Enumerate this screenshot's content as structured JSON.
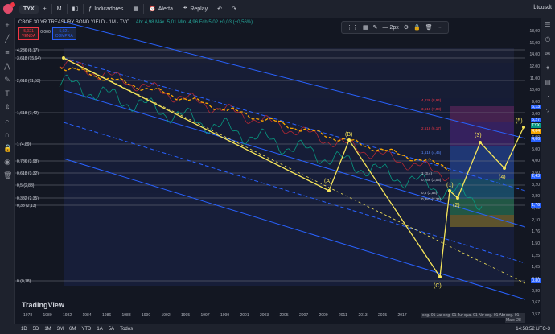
{
  "topbar": {
    "symbol": "TYX",
    "interval": "M",
    "indicators_label": "Indicadores",
    "alert_label": "Alerta",
    "replay_label": "Replay",
    "username": "btcusdt"
  },
  "legend": {
    "title": "CBOE 30 YR TREASURY BOND YIELD · 1M · TVC",
    "ohlc": "Abr 4,98  Máx. 5,01  Mín. 4,96  Fch 5,02  +0,03 (+0,56%)"
  },
  "trade": {
    "sell_price": "5,021",
    "sell_label": "VENDA",
    "spread": "0,000",
    "buy_price": "5,021",
    "buy_label": "COMPRA"
  },
  "drawing_toolbar": {
    "width_label": "2px"
  },
  "fib_levels": [
    {
      "label": "4,236 (8,17)"
    },
    {
      "label": "3,618 (15,64)"
    },
    {
      "label": "2,618 (11,53)"
    },
    {
      "label": "1,618 (7,42)"
    },
    {
      "label": "1 (4,89)"
    },
    {
      "label": "0,786 (3,98)"
    },
    {
      "label": "0,618 (3,32)"
    },
    {
      "label": "0,5 (2,83)"
    },
    {
      "label": "0,382 (2,35)"
    },
    {
      "label": "0,33 (2,13)"
    },
    {
      "label": "0 (0,78)"
    }
  ],
  "inner_fib_levels": [
    {
      "label": "4,236 (8,94)"
    },
    {
      "label": "3,618 (7,88)"
    },
    {
      "label": "2,618 (6,17)"
    },
    {
      "label": "1,618 (4,45)"
    },
    {
      "label": "1 (3,4)"
    },
    {
      "label": "0,786 (3,03)"
    },
    {
      "label": "0,5 (2,54)"
    },
    {
      "label": "0,382 (2,34)"
    }
  ],
  "wave_labels": {
    "a": "(A)",
    "b": "(B)",
    "c": "(C)",
    "w1": "(1)",
    "w2": "(2)",
    "w3": "(3)",
    "w4": "(4)",
    "w5": "(5)"
  },
  "price_axis": [
    "18,00",
    "16,00",
    "14,00",
    "12,00",
    "11,00",
    "10,00",
    "9,00",
    "8,00",
    "7,00",
    "6,00",
    "5,00",
    "4,00",
    "3,60",
    "3,20",
    "2,80",
    "2,43",
    "2,10",
    "1,76",
    "1,50",
    "1,25",
    "1,05",
    "0,91",
    "0,80",
    "0,67",
    "0,57"
  ],
  "price_tags": [
    {
      "text": "6,13",
      "color": "#2962ff"
    },
    {
      "text": "5,27",
      "color": "#2962ff"
    },
    {
      "text": "TYX",
      "color": "#089981"
    },
    {
      "text": "4,64",
      "color": "#f7a600"
    },
    {
      "text": "4,06",
      "color": "#2962ff"
    },
    {
      "text": "2,43",
      "color": "#2962ff"
    },
    {
      "text": "1,76",
      "color": "#2962ff"
    },
    {
      "text": "0,80",
      "color": "#2962ff"
    }
  ],
  "time_axis": [
    "1978",
    "1980",
    "1982",
    "1984",
    "1986",
    "1988",
    "1990",
    "1992",
    "1995",
    "1997",
    "1999",
    "2001",
    "2003",
    "2005",
    "2007",
    "2009",
    "2011",
    "2013",
    "2015",
    "2017"
  ],
  "time_axis_extra": [
    "seg. 01 Jan",
    "seg. 01 Jun",
    "qua. 01 Nov",
    "seg. 01 Abr",
    "seg. 01 Maio '28"
  ],
  "logo": "TradingView",
  "bottombar": {
    "ranges": [
      "1D",
      "5D",
      "1M",
      "3M",
      "6M",
      "YTD",
      "1A",
      "5A",
      "Todos"
    ],
    "clock": "14:58:52 UTC-3"
  },
  "colors": {
    "background": "#131722",
    "channel": "#2962ff",
    "wave": "#f7e65a",
    "ma": "#f7a600",
    "price": "#b22833"
  }
}
